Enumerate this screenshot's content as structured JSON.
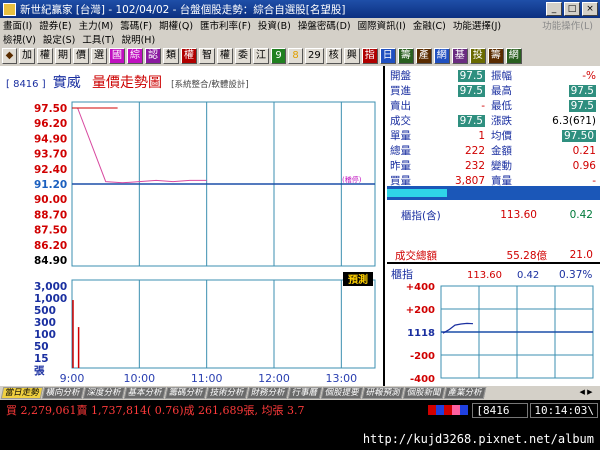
{
  "window": {
    "title": "新世紀贏家 [台灣] - 102/04/02 - 台盤個股走勢：綜合自選股[名望股]",
    "minimize_label": "_",
    "maximize_label": "□",
    "close_label": "×"
  },
  "menu": {
    "row1": [
      "畫面(I)",
      "證券(E)",
      "主力(M)",
      "籌碼(F)",
      "期權(Q)",
      "匯市利率(F)",
      "投資(B)",
      "操盤密碼(D)",
      "國際資訊(I)",
      "金融(C)",
      "功能選擇(J)"
    ],
    "row1_dim": "功能操作(L)",
    "row2": [
      "檢視(V)",
      "設定(S)",
      "工具(T)",
      "說明(H)"
    ]
  },
  "toolbar": [
    {
      "label": "◆",
      "color": "#5a2c00"
    },
    {
      "label": "加",
      "color": "#000000"
    },
    {
      "label": "權",
      "color": "#000000"
    },
    {
      "label": "期",
      "color": "#000000"
    },
    {
      "label": "價",
      "color": "#000000"
    },
    {
      "label": "選",
      "color": "#000000"
    },
    {
      "label": "國",
      "color": "#c010c0",
      "hl": true
    },
    {
      "label": "綜",
      "color": "#c010c0",
      "hl": true
    },
    {
      "label": "認",
      "color": "#8a1aa0",
      "hl": true
    },
    {
      "label": "類",
      "color": "#000000"
    },
    {
      "label": "權",
      "color": "#b00000",
      "hl": true
    },
    {
      "label": "智",
      "color": "#000000"
    },
    {
      "label": "權",
      "color": "#000000"
    },
    {
      "label": "委",
      "color": "#000000"
    },
    {
      "label": "江",
      "color": "#000000"
    },
    {
      "label": "9",
      "color": "#208020",
      "hl": true
    },
    {
      "label": "8",
      "color": "#e0a000"
    },
    {
      "label": "29",
      "color": "#000000"
    },
    {
      "label": "核",
      "color": "#000000"
    },
    {
      "label": "興",
      "color": "#000000"
    },
    {
      "label": "指",
      "color": "#b00000",
      "hl": true
    },
    {
      "label": "日",
      "color": "#2050c0",
      "hl": true
    },
    {
      "label": "籌",
      "color": "#2a6020",
      "hl": true
    },
    {
      "label": "產",
      "color": "#5a2c00",
      "hl": true
    },
    {
      "label": "網",
      "color": "#2050c0",
      "hl": true
    },
    {
      "label": "基",
      "color": "#6a2c80",
      "hl": true
    },
    {
      "label": "投",
      "color": "#6a6a00",
      "hl": true
    },
    {
      "label": "籌",
      "color": "#5a2c00",
      "hl": true
    },
    {
      "label": "網",
      "color": "#2a6020",
      "hl": true
    }
  ],
  "chart_header": {
    "code": "[ 8416 ]",
    "name": "實威",
    "title": "量價走勢圖",
    "subtitle": "[系統整合/軟體設計]"
  },
  "chart_data": {
    "type": "line",
    "price_axis": {
      "ticks": [
        "97.50",
        "96.20",
        "94.90",
        "93.70",
        "92.40",
        "91.20",
        "90.00",
        "88.70",
        "87.50",
        "86.20",
        "84.90"
      ],
      "ref_price": 91.2,
      "ref_label": "(稽停)",
      "ylim": [
        84.9,
        97.5
      ]
    },
    "volume_axis": {
      "ticks": [
        "3,000",
        "1,000",
        "500",
        "300",
        "100",
        "50",
        "15",
        "張"
      ]
    },
    "time_axis": {
      "ticks": [
        "9:00",
        "10:00",
        "11:00",
        "12:00",
        "13:00"
      ],
      "xlim": [
        "9:00",
        "13:30"
      ]
    },
    "series": [
      {
        "x": [
          "9:00",
          "9:05",
          "9:30",
          "9:45",
          "10:00",
          "10:15",
          "10:30",
          "10:45",
          "11:00"
        ],
        "values": [
          97.5,
          97.5,
          91.4,
          91.3,
          91.4,
          91.5,
          91.4,
          91.5,
          91.5
        ]
      }
    ],
    "volume": [
      {
        "x": "9:00",
        "value": 900
      },
      {
        "x": "9:05",
        "value": 60
      }
    ],
    "predict_label": "預測",
    "grid": true
  },
  "quote": {
    "rows": [
      {
        "l1": "開盤",
        "v1": "97.5",
        "v1_box": true,
        "l2": "振幅",
        "v2": "-%",
        "v2_cls": "red"
      },
      {
        "l1": "買進",
        "v1": "97.5",
        "v1_box": true,
        "l2": "最高",
        "v2": "97.5",
        "v2_box": true
      },
      {
        "l1": "賣出",
        "v1": "-",
        "v1_cls": "red",
        "l2": "最低",
        "v2": "97.5",
        "v2_box": true
      },
      {
        "l1": "成交",
        "v1": "97.5",
        "v1_box": true,
        "l2": "漲跌",
        "v2": "6.3(6?1)",
        "v2_cls": "blk"
      },
      {
        "l1": "單量",
        "v1": "1",
        "v1_cls": "red",
        "l2": "均價",
        "v2": "97.50",
        "v2_box": true
      },
      {
        "l1": "總量",
        "v1": "222",
        "v1_cls": "red",
        "l2": "金額",
        "v2": "0.21",
        "v2_cls": "red"
      },
      {
        "l1": "昨量",
        "v1": "232",
        "v1_cls": "red",
        "l2": "變動",
        "v2": "0.96",
        "v2_cls": "red"
      },
      {
        "l1": "買量",
        "v1": "3,807",
        "v1_cls": "red",
        "l2": "賣量",
        "v2": "-",
        "v2_cls": "red"
      }
    ],
    "buy_ratio": 0.28,
    "index_label": "櫃指(含)",
    "index_value": "113.60",
    "index_change": "0.42",
    "turnover_label": "成交總額",
    "turnover_value": "55.28億",
    "turnover_change": "21.0"
  },
  "mini_chart": {
    "title": "櫃指",
    "value": "113.60",
    "change": "0.42",
    "pct": "0.37%",
    "ticks": [
      "+400",
      "+200",
      "1118",
      "-200",
      "-400"
    ],
    "values": [
      -10,
      20,
      60,
      70,
      75,
      72
    ]
  },
  "tabs": {
    "items": [
      "當日走勢",
      "橫向分析",
      "深度分析",
      "基本分析",
      "籌碼分析",
      "技術分析",
      "財務分析",
      "行事曆",
      "個股提要",
      "研報預測",
      "個股新聞",
      "產業分析"
    ],
    "active": 0,
    "arrows": "◀ ▶"
  },
  "status": {
    "text": "買 2,279,061賣 1,737,814( 0.76)成 261,689張, 均張 3.7",
    "colors": [
      "#d00000",
      "#2040e0",
      "#d00000",
      "#ff60a0",
      "#2040e0"
    ],
    "code": "[8416",
    "time": "10:14:03\\"
  },
  "watermark": "http://kujd3268.pixnet.net/album"
}
